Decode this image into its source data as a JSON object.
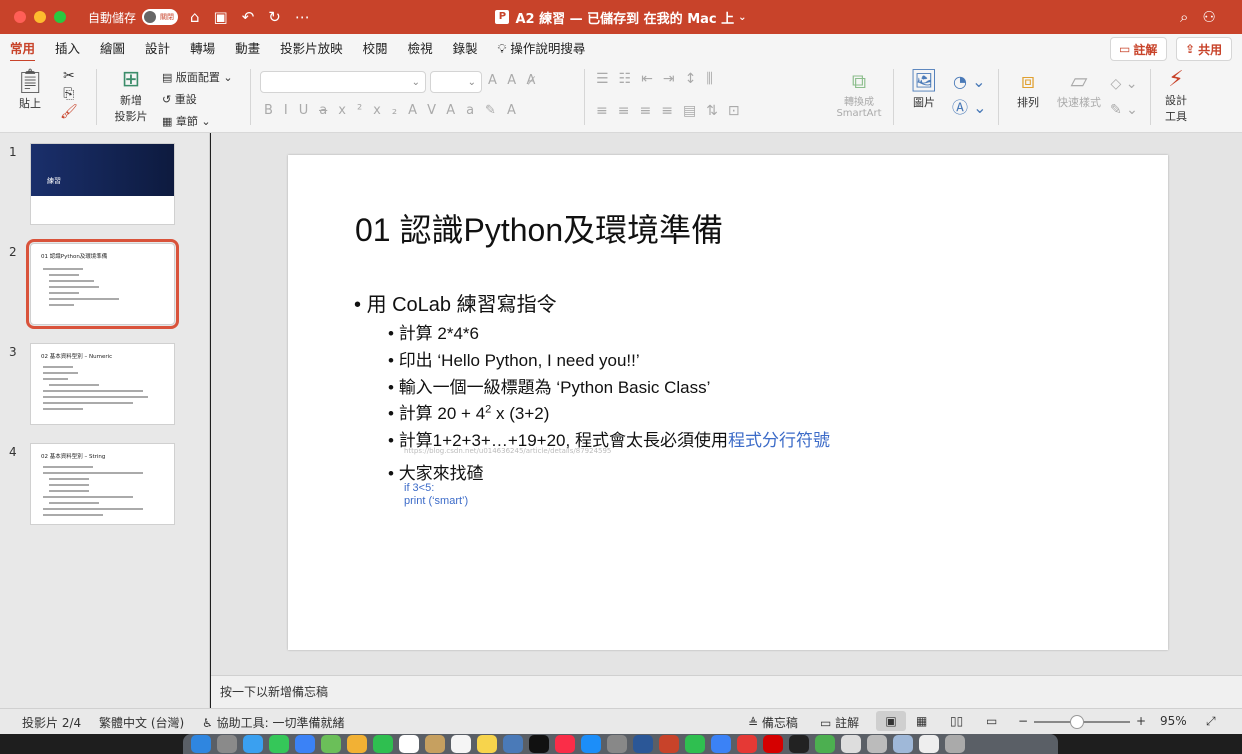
{
  "window": {
    "autosave_label": "自動儲存",
    "autosave_state": "關閉",
    "title": "A2 練習 — 已儲存到 在我的 Mac 上"
  },
  "menu": {
    "items": [
      "常用",
      "插入",
      "繪圖",
      "設計",
      "轉場",
      "動畫",
      "投影片放映",
      "校閱",
      "檢視",
      "錄製"
    ],
    "help": "操作說明搜尋",
    "comment_btn": "註解",
    "share_btn": "共用"
  },
  "ribbon": {
    "paste": "貼上",
    "new_slide_1": "新增",
    "new_slide_2": "投影片",
    "layout": "版面配置",
    "reset": "重設",
    "section": "章節",
    "convert_1": "轉換成",
    "convert_2": "SmartArt",
    "picture": "圖片",
    "arrange": "排列",
    "quick_style": "快速樣式",
    "designer_1": "設計",
    "designer_2": "工具"
  },
  "thumbnails": [
    {
      "num": "1",
      "title": "練習"
    },
    {
      "num": "2",
      "title": "01 認識Python及環境準備"
    },
    {
      "num": "3",
      "title": "02 基本資料型別 – Numeric"
    },
    {
      "num": "4",
      "title": "02 基本資料型別 – String"
    }
  ],
  "slide": {
    "title": "01 認識Python及環境準備",
    "bullet1": "用 CoLab 練習寫指令",
    "sub": [
      "計算 2*4*6",
      "印出 ‘Hello Python, I need you!!’",
      "輸入一個一級標題為 ‘Python Basic Class’",
      "計算 20 + 4",
      "計算1+2+3+…+19+20, 程式會太長必須使用",
      "大家來找碴"
    ],
    "sup": "2",
    "calc_rest": " x (3+2)",
    "link_text": "程式分行符號",
    "url": "https://blog.csdn.net/u014636245/article/details/87924595",
    "code1": "if 3<5:",
    "code2": "print (‘smart’)"
  },
  "notes": "按一下以新增備忘稿",
  "status": {
    "slide": "投影片 2/4",
    "lang": "繁體中文 (台灣)",
    "access": "協助工具: 一切準備就緒",
    "notes": "備忘稿",
    "comments": "註解",
    "zoom": "95%"
  },
  "colors": {
    "accent": "#c8432a",
    "link": "#3c6bc8"
  }
}
